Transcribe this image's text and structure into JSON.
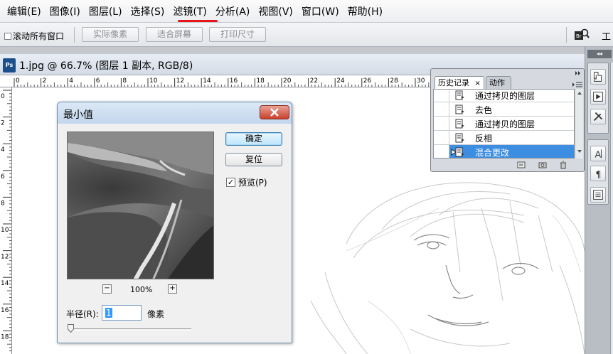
{
  "menubar": {
    "items": [
      "编辑(E)",
      "图像(I)",
      "图层(L)",
      "选择(S)",
      "滤镜(T)",
      "分析(A)",
      "视图(V)",
      "窗口(W)",
      "帮助(H)"
    ]
  },
  "options": {
    "scroll_all_windows": "滚动所有窗口",
    "actual_pixels": "实际像素",
    "fit_screen": "适合屏幕",
    "print_size": "打印尺寸",
    "workspace": "工"
  },
  "document": {
    "title": "1.jpg @ 66.7% (图层 1 副本, RGB/8)",
    "ps_badge": "Ps"
  },
  "ruler": {
    "top_labels": [
      "0",
      "2",
      "4",
      "6",
      "8",
      "10",
      "12",
      "14",
      "16",
      "18",
      "20",
      "22",
      "24",
      "26",
      "28",
      "30",
      "32",
      "34",
      "36",
      "38",
      "40"
    ],
    "left_labels": [
      "0",
      "2",
      "4",
      "6",
      "8",
      "10",
      "12",
      "14",
      "16",
      "18"
    ]
  },
  "history_panel": {
    "tabs": [
      {
        "label": "历史记录"
      },
      {
        "label": "动作"
      }
    ],
    "close_glyph": "×",
    "rows": [
      {
        "label": "通过拷贝的图层"
      },
      {
        "label": "去色"
      },
      {
        "label": "通过拷贝的图层"
      },
      {
        "label": "反相"
      },
      {
        "label": "混合更改"
      }
    ],
    "selected_row": "混合更改"
  },
  "dialog": {
    "title": "最小值",
    "ok_label": "确定",
    "reset_label": "复位",
    "preview_label": "预览(P)",
    "preview_checked": "✓",
    "zoom_out": "−",
    "zoom_in": "+",
    "zoom_level": "100%",
    "radius_label": "半径(R):",
    "radius_value": "1",
    "radius_unit": "像素",
    "radius_slider_fraction": 0.0
  },
  "colors": {
    "menu_highlight": "#e8141a",
    "selection": "#3d8ee0",
    "close_button": "#c9402b"
  }
}
